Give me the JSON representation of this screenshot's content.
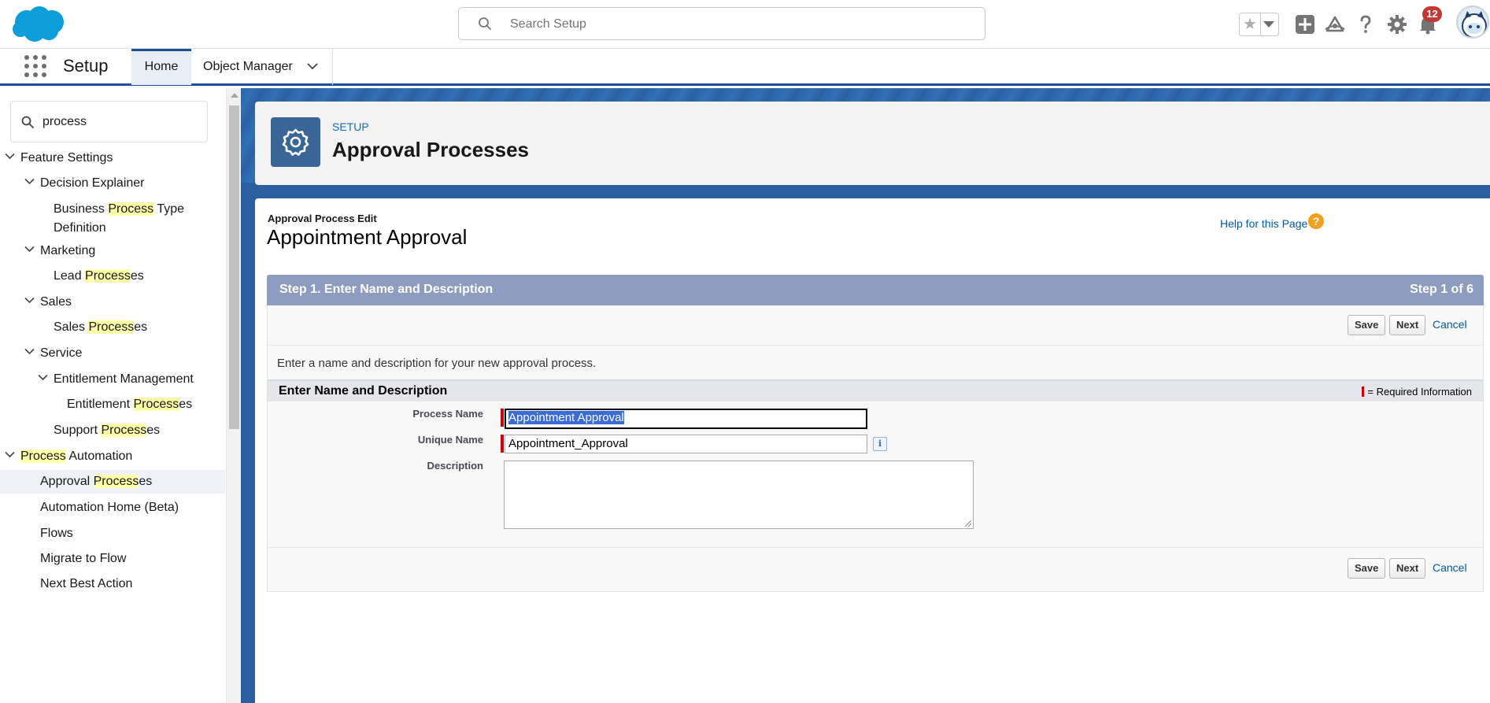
{
  "header": {
    "search_placeholder": "Search Setup",
    "notifications_count": "12",
    "icons": [
      "favorites-star-icon",
      "add-icon",
      "trailhead-icon",
      "help-icon",
      "gear-icon",
      "bell-icon",
      "avatar"
    ]
  },
  "nav": {
    "app_name": "Setup",
    "tabs": [
      {
        "label": "Home",
        "active": true
      },
      {
        "label": "Object Manager",
        "active": false
      }
    ]
  },
  "sidebar": {
    "quickfind_value": "process",
    "tree": [
      {
        "pre": "",
        "hl": "",
        "post": "Feature Settings",
        "level": 0,
        "expandable": true
      },
      {
        "pre": "",
        "hl": "",
        "post": "Decision Explainer",
        "level": 1,
        "expandable": true
      },
      {
        "pre": "Business ",
        "hl": "Process",
        "post": " Type",
        "line2": "Definition",
        "level": 2,
        "expandable": false
      },
      {
        "pre": "",
        "hl": "",
        "post": "Marketing",
        "level": 1,
        "expandable": true
      },
      {
        "pre": "Lead ",
        "hl": "Process",
        "post": "es",
        "level": 2,
        "expandable": false
      },
      {
        "pre": "",
        "hl": "",
        "post": "Sales",
        "level": 1,
        "expandable": true
      },
      {
        "pre": "Sales ",
        "hl": "Process",
        "post": "es",
        "level": 2,
        "expandable": false
      },
      {
        "pre": "",
        "hl": "",
        "post": "Service",
        "level": 1,
        "expandable": true
      },
      {
        "pre": "",
        "hl": "",
        "post": "Entitlement Management",
        "level": 2,
        "expandable": true
      },
      {
        "pre": "Entitlement ",
        "hl": "Process",
        "post": "es",
        "level": 3,
        "expandable": false
      },
      {
        "pre": "Support ",
        "hl": "Process",
        "post": "es",
        "level": 2,
        "expandable": false
      },
      {
        "pre": "",
        "hl": "Process",
        "post": " Automation",
        "level": 0,
        "expandable": true
      },
      {
        "pre": "Approval ",
        "hl": "Process",
        "post": "es",
        "level": 1,
        "expandable": false,
        "active": true
      },
      {
        "pre": "",
        "hl": "",
        "post": "Automation Home (Beta)",
        "level": 1,
        "expandable": false
      },
      {
        "pre": "",
        "hl": "",
        "post": "Flows",
        "level": 1,
        "expandable": false
      },
      {
        "pre": "",
        "hl": "",
        "post": "Migrate to Flow",
        "level": 1,
        "expandable": false
      },
      {
        "pre": "",
        "hl": "",
        "post": "Next Best Action",
        "level": 1,
        "expandable": false
      }
    ]
  },
  "page_header": {
    "eyebrow": "SETUP",
    "title": "Approval Processes"
  },
  "record": {
    "breadcrumb": "Approval Process Edit",
    "title": "Appointment Approval",
    "help_link": "Help for this Page",
    "help_icon": "?"
  },
  "step": {
    "title": "Step 1. Enter Name and Description",
    "counter": "Step 1 of 6",
    "save_label": "Save",
    "next_label": "Next",
    "cancel_label": "Cancel",
    "intro": "Enter a name and description for your new approval process.",
    "section_title": "Enter Name and Description",
    "required_legend": "= Required Information"
  },
  "form": {
    "process_name_label": "Process Name",
    "process_name_value": "Appointment Approval",
    "unique_name_label": "Unique Name",
    "unique_name_value": "Appointment_Approval",
    "info_icon": "i",
    "description_label": "Description",
    "description_value": ""
  },
  "colors": {
    "brand_blue": "#1b5297",
    "step_bar": "#8d9dbf",
    "required_red": "#cc0000",
    "link": "#015ba7",
    "highlight": "#ffffa9"
  }
}
